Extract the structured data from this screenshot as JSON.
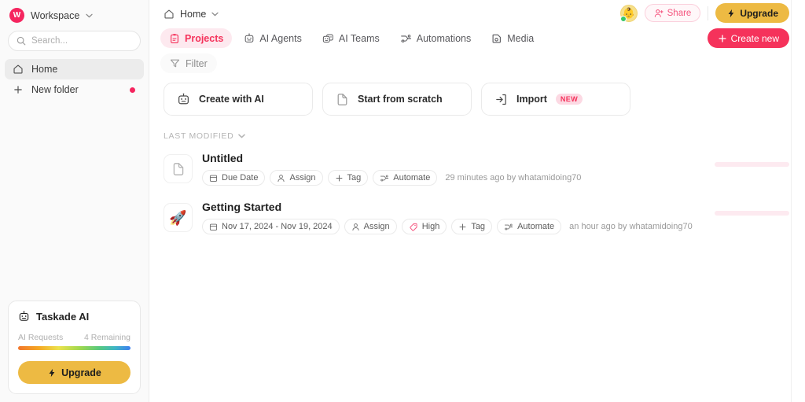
{
  "sidebar": {
    "workspace": {
      "initial": "W",
      "name": "Workspace"
    },
    "search": {
      "placeholder": "Search...",
      "value": ""
    },
    "nav": [
      {
        "label": "Home",
        "icon": "home-icon",
        "active": true,
        "dot": false
      },
      {
        "label": "New folder",
        "icon": "plus-icon",
        "active": false,
        "dot": true
      }
    ],
    "ai_card": {
      "title": "Taskade AI",
      "icon": "robot-icon",
      "requests_label": "AI Requests",
      "remaining_label": "4 Remaining",
      "progress_percent": 100,
      "upgrade_label": "Upgrade"
    }
  },
  "header": {
    "breadcrumb": {
      "label": "Home",
      "icon": "home-icon"
    },
    "avatar": {
      "glyph": "👶",
      "status": "online"
    },
    "share_label": "Share",
    "upgrade_label": "Upgrade",
    "create_label": "Create new"
  },
  "tabs": [
    {
      "label": "Projects",
      "icon": "clipboard-icon",
      "active": true
    },
    {
      "label": "AI Agents",
      "icon": "robot-icon",
      "active": false
    },
    {
      "label": "AI Teams",
      "icon": "robots-icon",
      "active": false
    },
    {
      "label": "Automations",
      "icon": "automation-icon",
      "active": false
    },
    {
      "label": "Media",
      "icon": "media-icon",
      "active": false
    }
  ],
  "filter": {
    "label": "Filter",
    "icon": "funnel-icon"
  },
  "actions": [
    {
      "label": "Create with AI",
      "icon": "robot-icon",
      "badge": ""
    },
    {
      "label": "Start from scratch",
      "icon": "page-icon",
      "badge": ""
    },
    {
      "label": "Import",
      "icon": "import-icon",
      "badge": "NEW"
    }
  ],
  "sort": {
    "label": "LAST MODIFIED",
    "icon": "chevron-down-icon"
  },
  "projects": [
    {
      "title": "Untitled",
      "icon": "page-icon",
      "emoji": "",
      "chips": [
        {
          "label": "Due Date",
          "icon": "calendar-icon",
          "style": "default"
        },
        {
          "label": "Assign",
          "icon": "person-icon",
          "style": "default"
        },
        {
          "label": "Tag",
          "icon": "plus-icon",
          "style": "default"
        },
        {
          "label": "Automate",
          "icon": "automation-icon",
          "style": "default"
        }
      ],
      "meta": "29 minutes ago by whatamidoing70"
    },
    {
      "title": "Getting Started",
      "icon": "rocket-emoji",
      "emoji": "🚀",
      "chips": [
        {
          "label": "Nov 17, 2024 - Nov 19, 2024",
          "icon": "calendar-icon",
          "style": "default"
        },
        {
          "label": "Assign",
          "icon": "person-icon",
          "style": "default"
        },
        {
          "label": "High",
          "icon": "tag-icon",
          "style": "priority"
        },
        {
          "label": "Tag",
          "icon": "plus-icon",
          "style": "default"
        },
        {
          "label": "Automate",
          "icon": "automation-icon",
          "style": "default"
        }
      ],
      "meta": "an hour ago by whatamidoing70"
    }
  ],
  "colors": {
    "brand_pink": "#f5325b",
    "brand_pink_soft": "#fde9ef",
    "upgrade_gold": "#edba43",
    "online_green": "#36c76a",
    "skeleton_pink": "#fdeaf0",
    "sidebar_bg": "#fafafa"
  }
}
